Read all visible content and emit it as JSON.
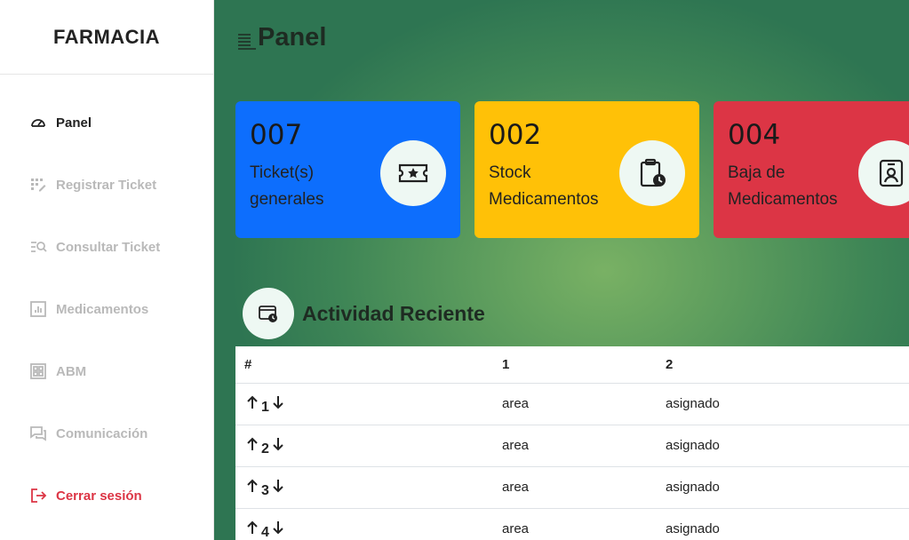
{
  "sidebar": {
    "brand": "FARMACIA",
    "items": [
      {
        "label": "Panel",
        "icon": "speedometer-icon"
      },
      {
        "label": "Registrar Ticket",
        "icon": "ui-checks-icon"
      },
      {
        "label": "Consultar Ticket",
        "icon": "list-search-icon"
      },
      {
        "label": "Medicamentos",
        "icon": "bar-chart-icon"
      },
      {
        "label": "ABM",
        "icon": "grid-icon"
      },
      {
        "label": "Comunicación",
        "icon": "chat-icon"
      },
      {
        "label": "Cerrar sesión",
        "icon": "logout-icon"
      }
    ]
  },
  "header": {
    "title": "Panel",
    "icon": "text-align-icon"
  },
  "cards": [
    {
      "value": "007",
      "label": "Ticket(s) generales",
      "color": "#0d6efd",
      "icon": "ticket-star-icon"
    },
    {
      "value": "002",
      "label": "Stock Medicamentos",
      "color": "#ffc107",
      "icon": "clipboard-clock-icon"
    },
    {
      "value": "004",
      "label": "Baja de Medicamentos",
      "color": "#dc3545",
      "icon": "person-badge-icon"
    }
  ],
  "activity": {
    "title": "Actividad Reciente",
    "icon": "window-clock-icon",
    "columns": [
      "#",
      "1",
      "2"
    ],
    "rows": [
      {
        "n": "1",
        "c1": "area",
        "c2": "asignado"
      },
      {
        "n": "2",
        "c1": "area",
        "c2": "asignado"
      },
      {
        "n": "3",
        "c1": "area",
        "c2": "asignado"
      },
      {
        "n": "4",
        "c1": "area",
        "c2": "asignado"
      }
    ]
  }
}
